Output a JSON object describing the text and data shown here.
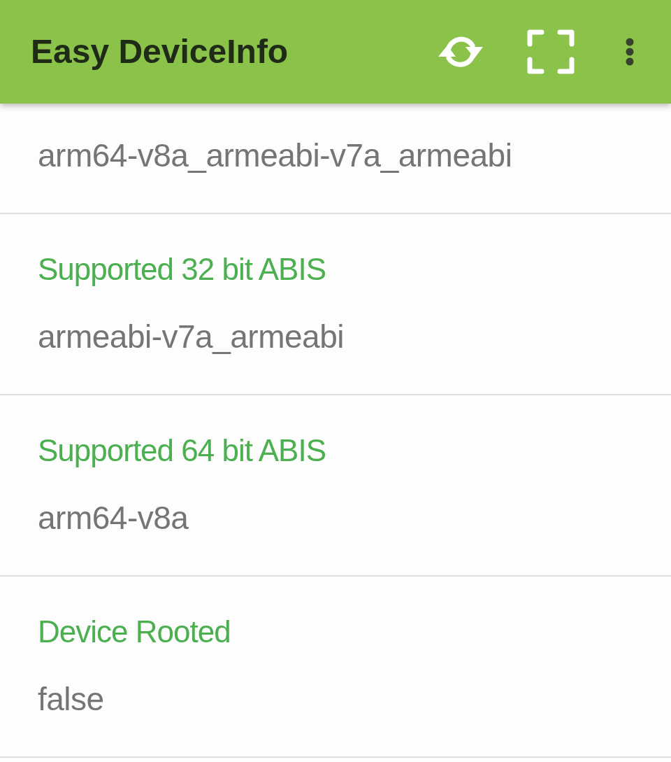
{
  "app_bar": {
    "title": "Easy DeviceInfo",
    "actions": [
      {
        "kind": "refresh"
      },
      {
        "kind": "fullscreen"
      },
      {
        "kind": "overflow"
      }
    ]
  },
  "items": [
    {
      "value": "arm64-v8a_armeabi-v7a_armeabi"
    },
    {
      "label": "Supported 32 bit ABIS",
      "value": "armeabi-v7a_armeabi"
    },
    {
      "label": "Supported 64 bit ABIS",
      "value": "arm64-v8a"
    },
    {
      "label": "Device Rooted",
      "value": "false"
    }
  ]
}
